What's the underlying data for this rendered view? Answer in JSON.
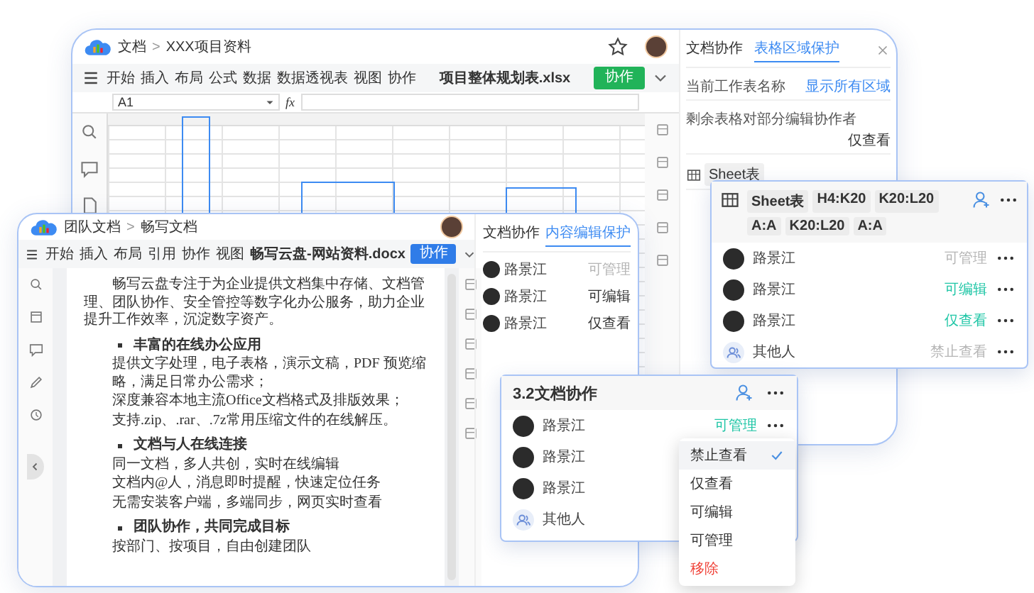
{
  "spreadsheet_window": {
    "breadcrumb": [
      "文档",
      "XXX项目资料"
    ],
    "separator": ">",
    "menu": [
      "开始",
      "插入",
      "布局",
      "公式",
      "数据",
      "数据透视表",
      "视图",
      "协作"
    ],
    "file_title": "项目整体规划表.xlsx",
    "collab_button": "协作",
    "cell_ref": "A1",
    "formula_label": "fx",
    "side_panel": {
      "tabs": [
        {
          "label": "文档协作",
          "selected": false
        },
        {
          "label": "表格区域保护",
          "selected": true
        }
      ],
      "rows": [
        {
          "label": "当前工作表名称",
          "value": "显示所有区域",
          "kind": "link"
        },
        {
          "label": "剩余表格对部分编辑协作者",
          "value": "仅查看",
          "kind": "text"
        }
      ],
      "sheet_chip": "Sheet表"
    }
  },
  "document_window": {
    "breadcrumb": [
      "团队文档",
      "畅写文档"
    ],
    "separator": ">",
    "menu": [
      "开始",
      "插入",
      "布局",
      "引用",
      "协作",
      "视图"
    ],
    "file_title": "畅写云盘-网站资料.docx",
    "collab_button": "协作",
    "content": [
      {
        "kind": "paragraph",
        "text": "畅写云盘专注于为企业提供文档集中存储、文档管理、团队协作、安全管控等数字化办公服务，助力企业提升工作效率，沉淀数字资产。"
      },
      {
        "kind": "bullet",
        "text": "丰富的在线办公应用"
      },
      {
        "kind": "line",
        "text": "提供文字处理，电子表格，演示文稿，PDF 预览缩略，满足日常办公需求；"
      },
      {
        "kind": "line",
        "text": "深度兼容本地主流Office文档格式及排版效果；"
      },
      {
        "kind": "line",
        "text": "支持.zip、.rar、.7z常用压缩文件的在线解压。"
      },
      {
        "kind": "bullet",
        "text": "文档与人在线连接"
      },
      {
        "kind": "line",
        "text": "同一文档，多人共创，实时在线编辑"
      },
      {
        "kind": "line",
        "text": "文档内@人，消息即时提醒，快速定位任务"
      },
      {
        "kind": "line",
        "text": "无需安装客户端，多端同步，网页实时查看"
      },
      {
        "kind": "bullet",
        "text": "团队协作，共同完成目标"
      },
      {
        "kind": "line",
        "text": "按部门、按项目，自由创建团队"
      }
    ],
    "side_panel": {
      "tabs": [
        {
          "label": "文档协作",
          "selected": false
        },
        {
          "label": "内容编辑保护",
          "selected": true
        }
      ],
      "members": [
        {
          "kind": "person",
          "name": "路景江",
          "permission": "可管理",
          "highlighted": false
        },
        {
          "kind": "person",
          "name": "路景江",
          "permission": "可编辑",
          "highlighted": true
        },
        {
          "kind": "person",
          "name": "路景江",
          "permission": "仅查看",
          "highlighted": true
        }
      ]
    }
  },
  "permission_panel": {
    "ranges": [
      "Sheet表",
      "H4:K20",
      "K20:L20",
      "A:A",
      "K20:L20",
      "A:A"
    ],
    "members": [
      {
        "kind": "person",
        "name": "路景江",
        "permission": "可管理",
        "highlighted": false
      },
      {
        "kind": "person",
        "name": "路景江",
        "permission": "可编辑",
        "highlighted": true
      },
      {
        "kind": "person",
        "name": "路景江",
        "permission": "仅查看",
        "highlighted": true
      },
      {
        "kind": "others",
        "name": "其他人",
        "permission": "禁止查看",
        "highlighted": false
      }
    ]
  },
  "collab_panel": {
    "title": "3.2文档协作",
    "members": [
      {
        "kind": "person",
        "name": "路景江",
        "permission": "可管理",
        "highlighted": true
      },
      {
        "kind": "person",
        "name": "路景江"
      },
      {
        "kind": "person",
        "name": "路景江"
      },
      {
        "kind": "others",
        "name": "其他人"
      }
    ]
  },
  "permission_menu": {
    "items": [
      {
        "label": "禁止查看",
        "selected": true,
        "kind": "normal"
      },
      {
        "label": "仅查看",
        "selected": false,
        "kind": "normal"
      },
      {
        "label": "可编辑",
        "selected": false,
        "kind": "normal"
      },
      {
        "label": "可管理",
        "selected": false,
        "kind": "normal"
      },
      {
        "label": "移除",
        "selected": false,
        "kind": "danger"
      }
    ]
  }
}
